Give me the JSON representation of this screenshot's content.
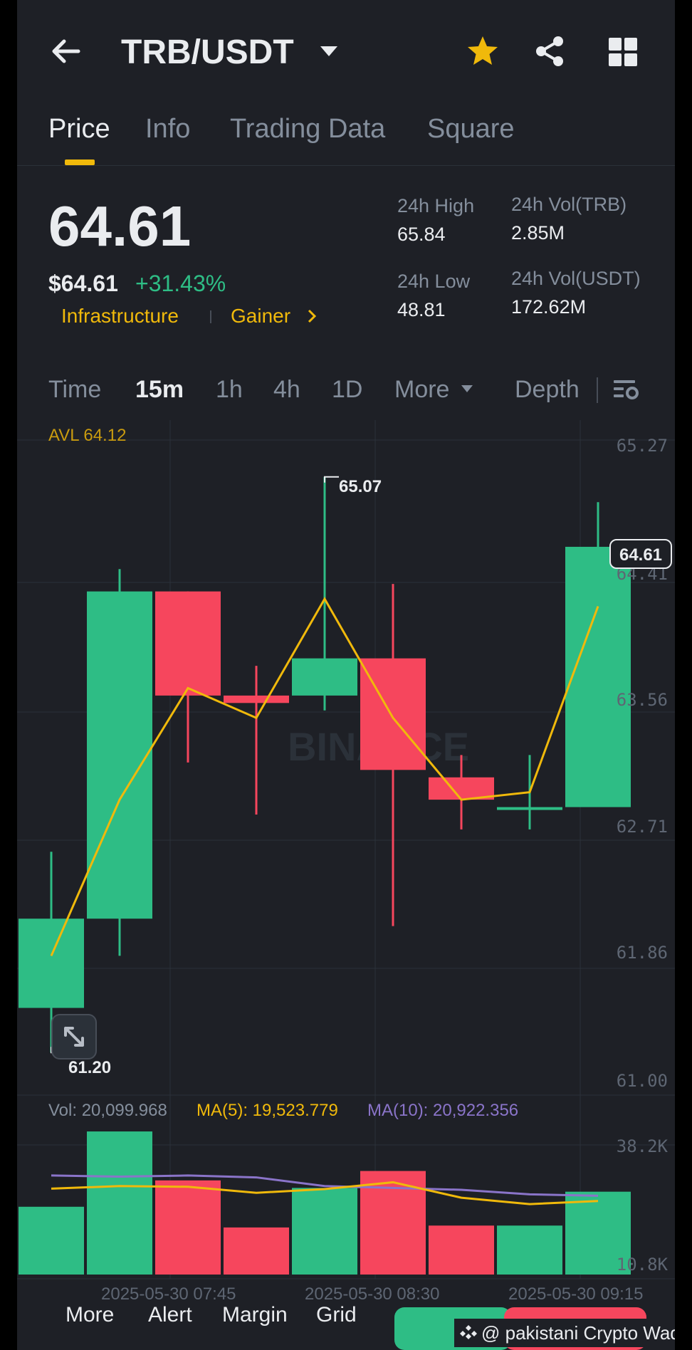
{
  "header": {
    "title": "TRB/USDT"
  },
  "tabs": [
    {
      "label": "Price",
      "active": true
    },
    {
      "label": "Info",
      "active": false
    },
    {
      "label": "Trading Data",
      "active": false
    },
    {
      "label": "Square",
      "active": false
    }
  ],
  "ticker": {
    "last_price": "64.61",
    "usd_price": "$64.61",
    "change": "+31.43%",
    "tag_category": "Infrastructure",
    "tag_gainer": "Gainer",
    "high_label": "24h High",
    "high_value": "65.84",
    "low_label": "24h Low",
    "low_value": "48.81",
    "vol_trb_label": "24h Vol(TRB)",
    "vol_trb_value": "2.85M",
    "vol_usdt_label": "24h Vol(USDT)",
    "vol_usdt_value": "172.62M"
  },
  "timeframes": {
    "time": "Time",
    "m15": "15m",
    "h1": "1h",
    "h4": "4h",
    "d1": "1D",
    "more": "More",
    "depth": "Depth"
  },
  "chart": {
    "avl": "AVL 64.12",
    "watermark": "BINANCE",
    "max_label": "65.07",
    "min_label": "61.20",
    "current_price_tag": "64.61",
    "y_ticks": [
      "65.27",
      "64.41",
      "63.56",
      "62.71",
      "61.86",
      "61.00"
    ],
    "vol_line": "Vol: 20,099.968",
    "ma5_line": "MA(5): 19,523.779",
    "ma10_line": "MA(10): 20,922.356",
    "vol_ticks": [
      "38.2K",
      "10.8K"
    ],
    "x_ticks": [
      "2025-05-30 07:45",
      "2025-05-30 08:30",
      "2025-05-30 09:15"
    ]
  },
  "chart_data": {
    "type": "candlestick",
    "y_range": [
      61.0,
      65.27
    ],
    "candles": [
      {
        "open": 61.5,
        "close": 62.1,
        "high": 62.55,
        "low": 61.2
      },
      {
        "open": 62.1,
        "close": 64.3,
        "high": 64.45,
        "low": 61.85
      },
      {
        "open": 64.3,
        "close": 63.6,
        "high": 64.3,
        "low": 63.15
      },
      {
        "open": 63.6,
        "close": 63.55,
        "high": 63.8,
        "low": 62.8
      },
      {
        "open": 63.6,
        "close": 63.85,
        "high": 65.07,
        "low": 63.5
      },
      {
        "open": 63.85,
        "close": 63.1,
        "high": 64.35,
        "low": 62.05
      },
      {
        "open": 63.05,
        "close": 62.9,
        "high": 63.2,
        "low": 62.7
      },
      {
        "open": 62.85,
        "close": 62.85,
        "high": 63.2,
        "low": 62.7
      },
      {
        "open": 62.85,
        "close": 64.6,
        "high": 64.9,
        "low": 62.85
      }
    ],
    "ma_line": [
      61.85,
      62.9,
      63.65,
      63.45,
      64.25,
      63.45,
      62.9,
      62.95,
      64.2
    ],
    "volume": {
      "range": [
        10800,
        38200
      ],
      "values": [
        18000,
        38000,
        25000,
        12500,
        23000,
        27500,
        13000,
        13000,
        22000
      ],
      "ma5": [
        22800,
        23500,
        23300,
        21700,
        22700,
        24500,
        20400,
        18700,
        19523.779
      ],
      "ma10": [
        26300,
        26000,
        26300,
        25800,
        23500,
        23000,
        22500,
        21300,
        20922.356
      ]
    }
  },
  "bottom_bar": {
    "more": "More",
    "alert": "Alert",
    "margin": "Margin",
    "grid": "Grid",
    "credit": "@ pakistani Crypto Waq..."
  },
  "colors": {
    "up": "#2ebd85",
    "down": "#f6465d",
    "accent": "#f0b90b",
    "ma10": "#8a74c9",
    "bg": "#1e2026"
  }
}
